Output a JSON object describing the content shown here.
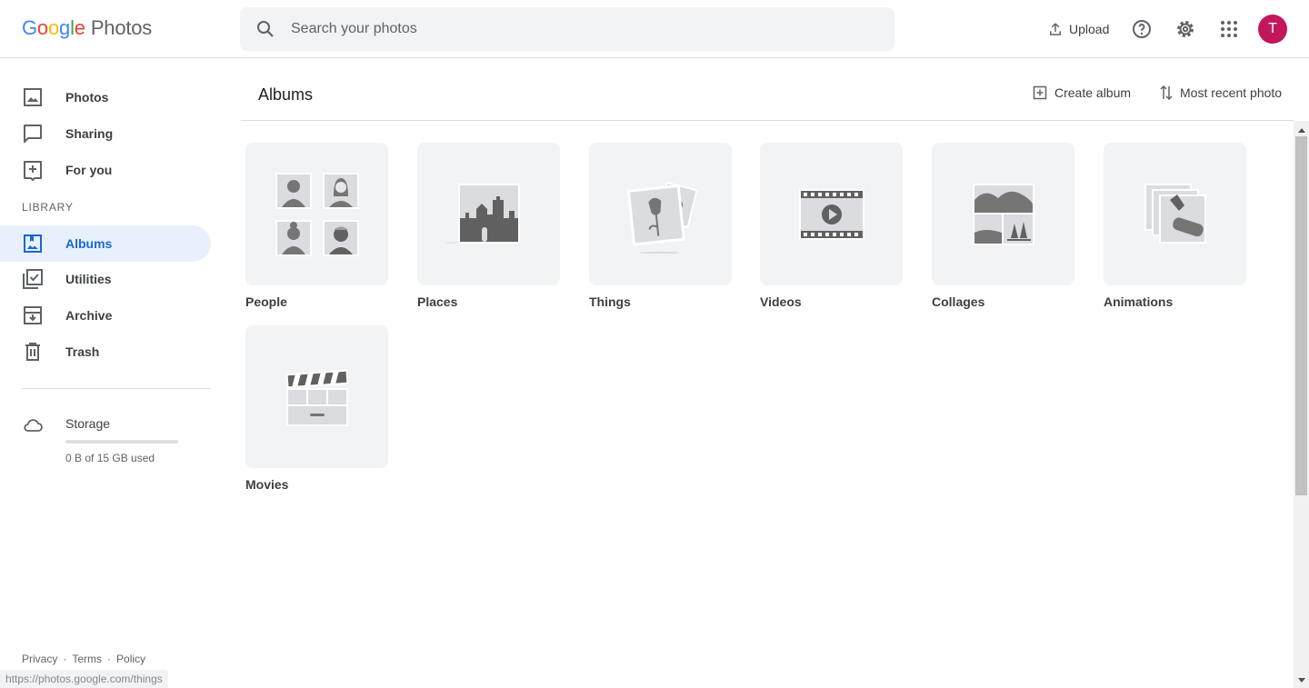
{
  "header": {
    "logo_letters": [
      "G",
      "o",
      "o",
      "g",
      "l",
      "e"
    ],
    "product": "Photos",
    "search_placeholder": "Search your photos",
    "upload_label": "Upload",
    "avatar_initial": "T"
  },
  "sidebar": {
    "items": [
      {
        "label": "Photos"
      },
      {
        "label": "Sharing"
      },
      {
        "label": "For you"
      },
      {
        "label": "Albums"
      },
      {
        "label": "Utilities"
      },
      {
        "label": "Archive"
      },
      {
        "label": "Trash"
      }
    ],
    "library_heading": "LIBRARY",
    "storage_label": "Storage",
    "storage_used_fraction": 0,
    "storage_text": "0 B of 15 GB used"
  },
  "footer": {
    "privacy": "Privacy",
    "sep": "·",
    "terms": "Terms",
    "policy": "Policy"
  },
  "status_url": "https://photos.google.com/things",
  "main": {
    "title": "Albums",
    "create_album": "Create album",
    "sort_label": "Most recent photo",
    "albums": [
      {
        "label": "People"
      },
      {
        "label": "Places"
      },
      {
        "label": "Things"
      },
      {
        "label": "Videos"
      },
      {
        "label": "Collages"
      },
      {
        "label": "Animations"
      },
      {
        "label": "Movies"
      }
    ]
  },
  "colors": {
    "accent": "#1967d2",
    "active_bg": "#e8f0fe",
    "avatar": "#c2185b"
  }
}
